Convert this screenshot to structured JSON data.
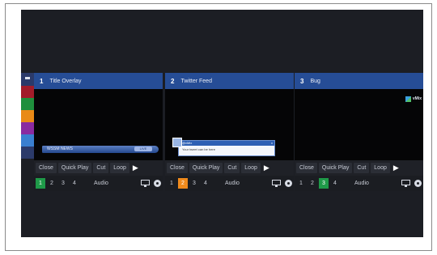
{
  "app": {
    "swatches": [
      "#a21c2a",
      "#1f8f3c",
      "#e98a16",
      "#8a2aa0",
      "#3a7fd0",
      "#2b3a6a"
    ],
    "panes": [
      {
        "number": "1",
        "title": "Title Overlay",
        "preview": "lower-third",
        "preview_text": "WSSM NEWS ",
        "preview_tag": "LIVE",
        "controls": {
          "close": "Close",
          "quick_play": "Quick Play",
          "cut": "Cut",
          "loop": "Loop",
          "play": "▶"
        },
        "inputs": [
          "1",
          "2",
          "3",
          "4"
        ],
        "active_input": "1",
        "active_color": "green",
        "audio": "Audio"
      },
      {
        "number": "2",
        "title": "Twitter Feed",
        "preview": "tweet",
        "preview_handle": "@vMix",
        "preview_text": "Your tweet can be here",
        "controls": {
          "close": "Close",
          "quick_play": "Quick Play",
          "cut": "Cut",
          "loop": "Loop",
          "play": "▶"
        },
        "inputs": [
          "1",
          "2",
          "3",
          "4"
        ],
        "active_input": "2",
        "active_color": "orange",
        "audio": "Audio"
      },
      {
        "number": "3",
        "title": "Bug",
        "preview": "bug",
        "preview_text": "vMix",
        "controls": {
          "close": "Close",
          "quick_play": "Quick Play",
          "cut": "Cut",
          "loop": "Loop",
          "play": "▶"
        },
        "inputs": [
          "1",
          "2",
          "3",
          "4"
        ],
        "active_input": "3",
        "active_color": "green",
        "audio": "Audio"
      }
    ],
    "icons": {
      "monitor": "monitor-icon",
      "settings": "gear-icon",
      "play": "play-icon"
    }
  }
}
